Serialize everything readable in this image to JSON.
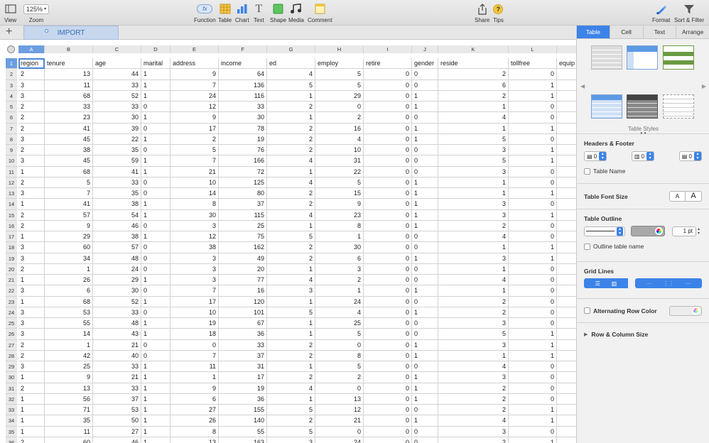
{
  "toolbar": {
    "view": "View",
    "zoom_value": "125%",
    "zoom": "Zoom",
    "function": "Function",
    "function_glyph": "fx",
    "table": "Table",
    "chart": "Chart",
    "text": "Text",
    "text_glyph": "T",
    "shape": "Shape",
    "media": "Media",
    "comment": "Comment",
    "share": "Share",
    "tips": "Tips",
    "tips_glyph": "?",
    "format": "Format",
    "sort_filter": "Sort & Filter"
  },
  "sheets": {
    "add": "+",
    "active": "IMPORT"
  },
  "columns": [
    "A",
    "B",
    "C",
    "D",
    "E",
    "F",
    "G",
    "H",
    "I",
    "J",
    "K",
    "L"
  ],
  "header_row": [
    "region",
    "tenure",
    "age",
    "marital",
    "address",
    "income",
    "ed",
    "employ",
    "retire",
    "gender",
    "reside",
    "tollfree",
    "equip"
  ],
  "rows": [
    [
      "2",
      "13",
      "44",
      "1",
      "9",
      "64",
      "4",
      "5",
      "0",
      "0",
      "2",
      "0"
    ],
    [
      "3",
      "11",
      "33",
      "1",
      "7",
      "136",
      "5",
      "5",
      "0",
      "0",
      "6",
      "1"
    ],
    [
      "3",
      "68",
      "52",
      "1",
      "24",
      "116",
      "1",
      "29",
      "0",
      "1",
      "2",
      "1"
    ],
    [
      "2",
      "33",
      "33",
      "0",
      "12",
      "33",
      "2",
      "0",
      "0",
      "1",
      "1",
      "0"
    ],
    [
      "2",
      "23",
      "30",
      "1",
      "9",
      "30",
      "1",
      "2",
      "0",
      "0",
      "4",
      "0"
    ],
    [
      "2",
      "41",
      "39",
      "0",
      "17",
      "78",
      "2",
      "16",
      "0",
      "1",
      "1",
      "1"
    ],
    [
      "3",
      "45",
      "22",
      "1",
      "2",
      "19",
      "2",
      "4",
      "0",
      "1",
      "5",
      "0"
    ],
    [
      "2",
      "38",
      "35",
      "0",
      "5",
      "76",
      "2",
      "10",
      "0",
      "0",
      "3",
      "1"
    ],
    [
      "3",
      "45",
      "59",
      "1",
      "7",
      "166",
      "4",
      "31",
      "0",
      "0",
      "5",
      "1"
    ],
    [
      "1",
      "68",
      "41",
      "1",
      "21",
      "72",
      "1",
      "22",
      "0",
      "0",
      "3",
      "0"
    ],
    [
      "2",
      "5",
      "33",
      "0",
      "10",
      "125",
      "4",
      "5",
      "0",
      "1",
      "1",
      "0"
    ],
    [
      "3",
      "7",
      "35",
      "0",
      "14",
      "80",
      "2",
      "15",
      "0",
      "1",
      "1",
      "1"
    ],
    [
      "1",
      "41",
      "38",
      "1",
      "8",
      "37",
      "2",
      "9",
      "0",
      "1",
      "3",
      "0"
    ],
    [
      "2",
      "57",
      "54",
      "1",
      "30",
      "115",
      "4",
      "23",
      "0",
      "1",
      "3",
      "1"
    ],
    [
      "2",
      "9",
      "46",
      "0",
      "3",
      "25",
      "1",
      "8",
      "0",
      "1",
      "2",
      "0"
    ],
    [
      "1",
      "29",
      "38",
      "1",
      "12",
      "75",
      "5",
      "1",
      "0",
      "0",
      "4",
      "0"
    ],
    [
      "3",
      "60",
      "57",
      "0",
      "38",
      "162",
      "2",
      "30",
      "0",
      "0",
      "1",
      "1"
    ],
    [
      "3",
      "34",
      "48",
      "0",
      "3",
      "49",
      "2",
      "6",
      "0",
      "1",
      "3",
      "1"
    ],
    [
      "2",
      "1",
      "24",
      "0",
      "3",
      "20",
      "1",
      "3",
      "0",
      "0",
      "1",
      "0"
    ],
    [
      "1",
      "26",
      "29",
      "1",
      "3",
      "77",
      "4",
      "2",
      "0",
      "0",
      "4",
      "0"
    ],
    [
      "3",
      "6",
      "30",
      "0",
      "7",
      "16",
      "3",
      "1",
      "0",
      "1",
      "1",
      "0"
    ],
    [
      "1",
      "68",
      "52",
      "1",
      "17",
      "120",
      "1",
      "24",
      "0",
      "0",
      "2",
      "0"
    ],
    [
      "3",
      "53",
      "33",
      "0",
      "10",
      "101",
      "5",
      "4",
      "0",
      "1",
      "2",
      "0"
    ],
    [
      "3",
      "55",
      "48",
      "1",
      "19",
      "67",
      "1",
      "25",
      "0",
      "0",
      "3",
      "0"
    ],
    [
      "3",
      "14",
      "43",
      "1",
      "18",
      "36",
      "1",
      "5",
      "0",
      "0",
      "5",
      "1"
    ],
    [
      "2",
      "1",
      "21",
      "0",
      "0",
      "33",
      "2",
      "0",
      "0",
      "1",
      "3",
      "1"
    ],
    [
      "2",
      "42",
      "40",
      "0",
      "7",
      "37",
      "2",
      "8",
      "0",
      "1",
      "1",
      "1"
    ],
    [
      "3",
      "25",
      "33",
      "1",
      "11",
      "31",
      "1",
      "5",
      "0",
      "0",
      "4",
      "0"
    ],
    [
      "1",
      "9",
      "21",
      "1",
      "1",
      "17",
      "2",
      "2",
      "0",
      "1",
      "3",
      "0"
    ],
    [
      "2",
      "13",
      "33",
      "1",
      "9",
      "19",
      "4",
      "0",
      "0",
      "1",
      "2",
      "0"
    ],
    [
      "1",
      "56",
      "37",
      "1",
      "6",
      "36",
      "1",
      "13",
      "0",
      "1",
      "2",
      "0"
    ],
    [
      "1",
      "71",
      "53",
      "1",
      "27",
      "155",
      "5",
      "12",
      "0",
      "0",
      "2",
      "1"
    ],
    [
      "1",
      "35",
      "50",
      "1",
      "26",
      "140",
      "2",
      "21",
      "0",
      "1",
      "4",
      "1"
    ],
    [
      "1",
      "11",
      "27",
      "1",
      "8",
      "55",
      "5",
      "0",
      "0",
      "0",
      "3",
      "0"
    ],
    [
      "2",
      "60",
      "46",
      "1",
      "13",
      "163",
      "3",
      "24",
      "0",
      "0",
      "2",
      "1"
    ]
  ],
  "sidebar": {
    "tabs": [
      "Table",
      "Cell",
      "Text",
      "Arrange"
    ],
    "table_styles": "Table Styles",
    "headers_footer": "Headers & Footer",
    "header_rows": "0",
    "header_cols": "0",
    "footer_rows": "0",
    "table_name": "Table Name",
    "font_size": "Table Font Size",
    "font_small": "A",
    "font_large": "A",
    "outline": "Table Outline",
    "outline_width": "1 pt",
    "outline_name": "Outline table name",
    "grid_lines": "Grid Lines",
    "alt_row": "Alternating Row Color",
    "row_col_size": "Row & Column Size"
  },
  "colors": {
    "accent": "#3b83e8",
    "selection": "#6c9ee0",
    "sheet_tab": "#c6d7ee"
  }
}
